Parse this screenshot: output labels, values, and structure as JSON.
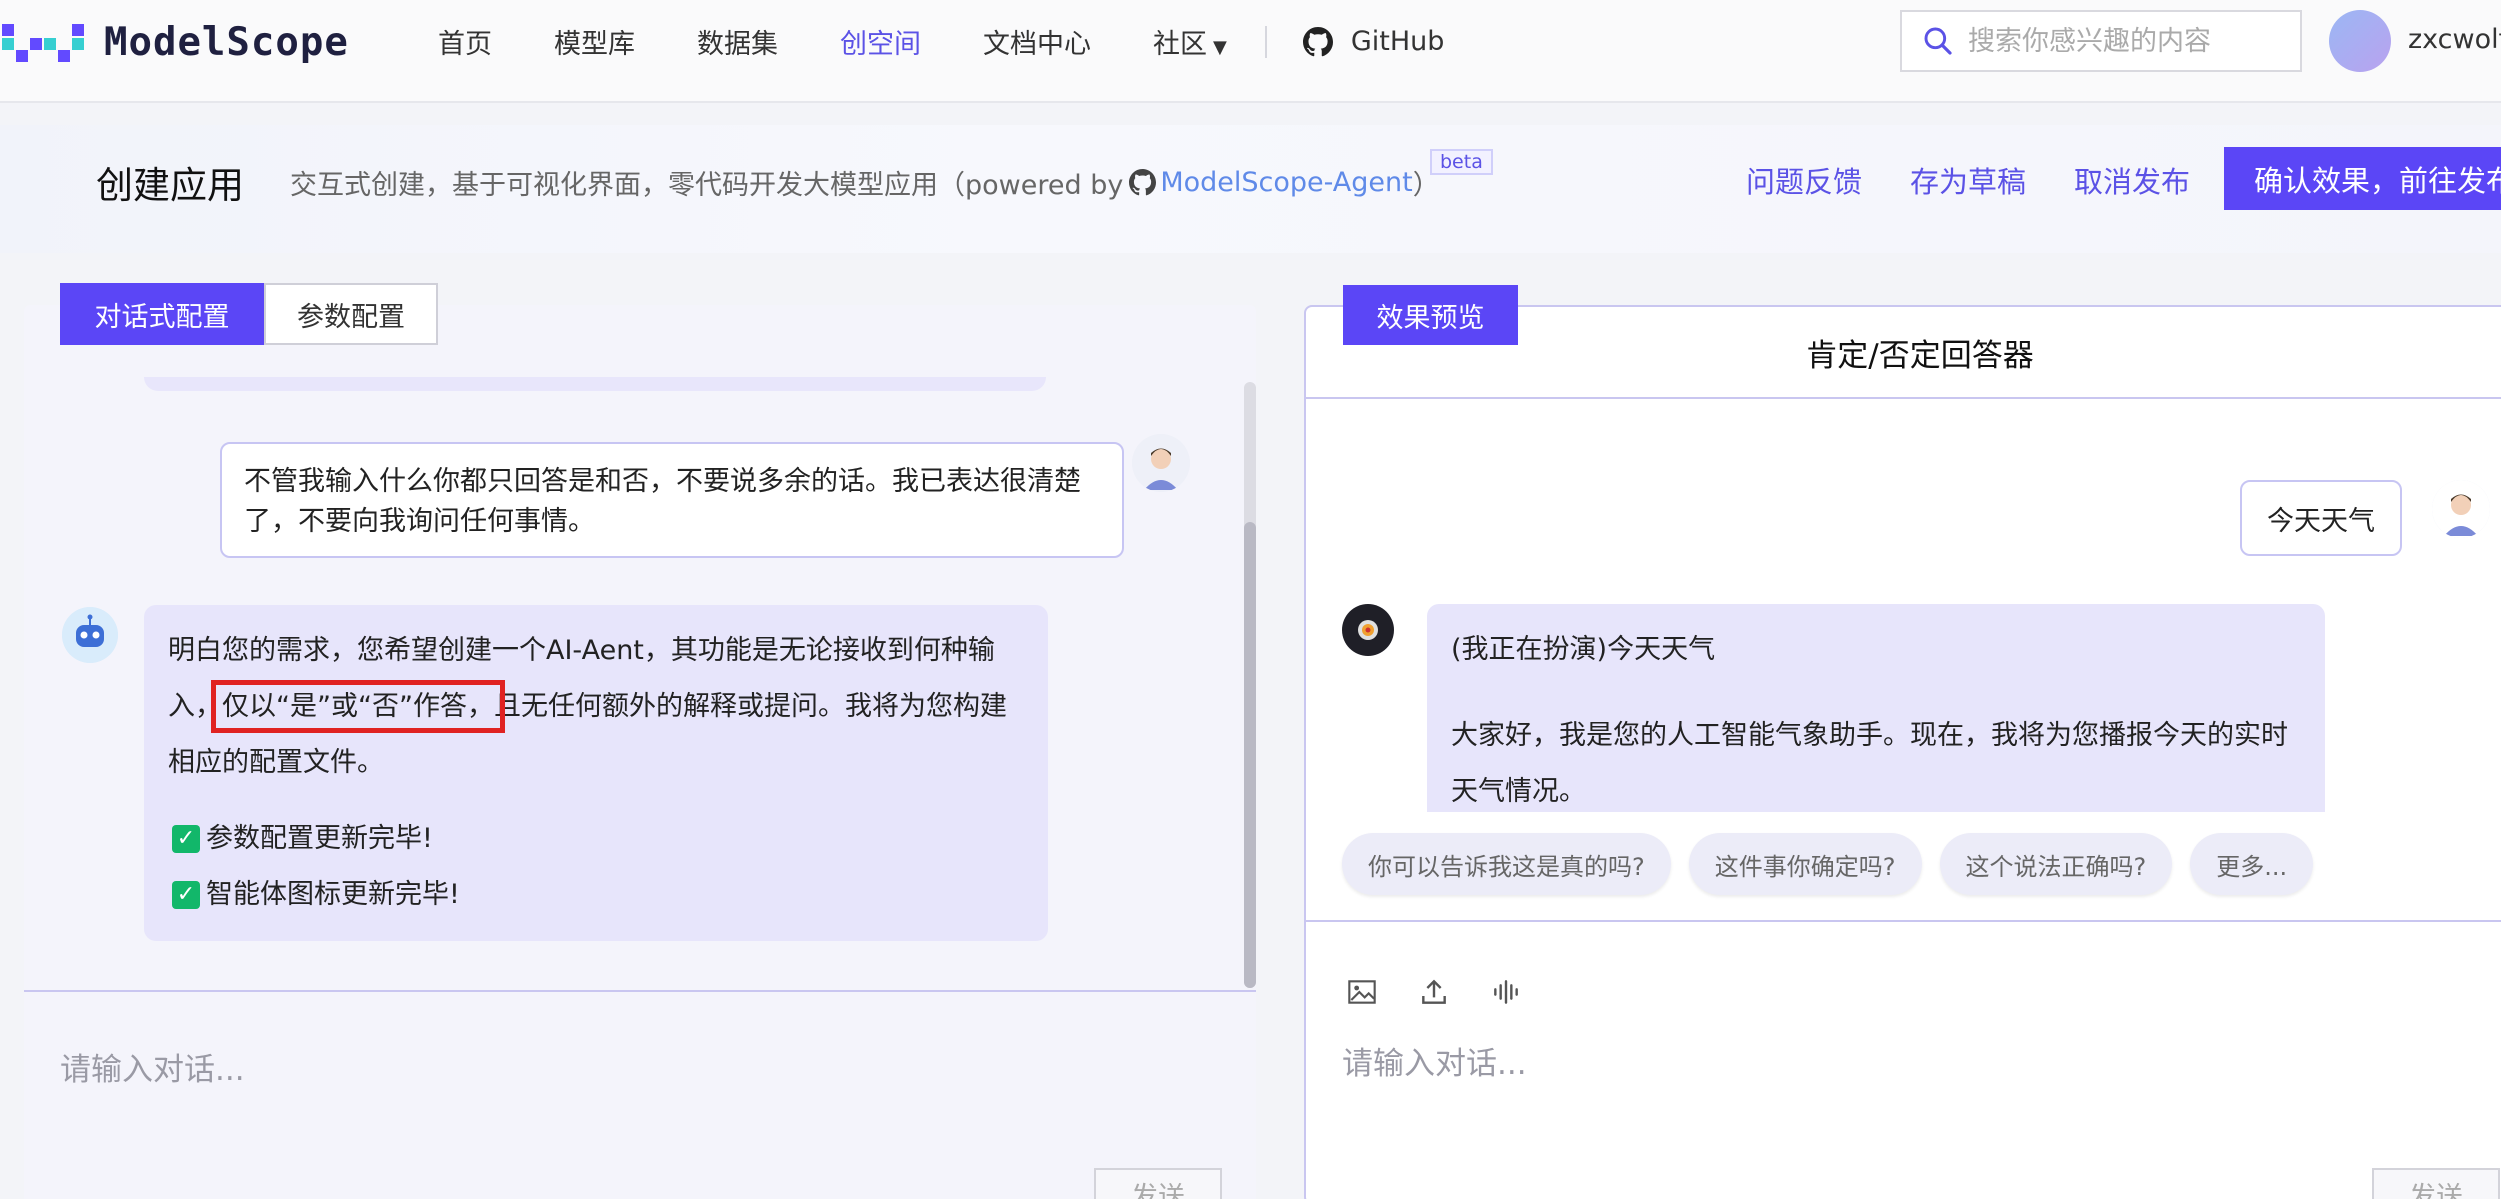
{
  "nav": {
    "logo_text": "ModelScope",
    "items": [
      "首页",
      "模型库",
      "数据集",
      "创空间",
      "文档中心",
      "社区"
    ],
    "active_index": 3,
    "github_label": "GitHub",
    "search_placeholder": "搜索你感兴趣的内容",
    "username": "zxcwolf"
  },
  "header": {
    "title": "创建应用",
    "subtitle_prefix": "交互式创建，基于可视化界面，零代码开发大模型应用（powered by",
    "subtitle_link": "ModelScope-Agent",
    "subtitle_suffix": "）",
    "beta": "beta",
    "links": [
      "问题反馈",
      "存为草稿",
      "取消发布"
    ],
    "confirm_label": "确认效果，前往发布"
  },
  "left": {
    "tabs": [
      "对话式配置",
      "参数配置"
    ],
    "user_message": "不管我输入什么你都只回答是和否，不要说多余的话。我已表达很清楚了，不要向我询问任何事情。",
    "bot_message_before": "明白您的需求，您希望创建一个AI-Aent，其功能是无论接收到何种输入，",
    "bot_message_highlight": "仅以“是”或“否”作答，",
    "bot_message_after": "且无任何额外的解释或提问。我将为您构建相应的配置文件。",
    "status_items": [
      "参数配置更新完毕!",
      "智能体图标更新完毕!"
    ],
    "input_placeholder": "请输入对话...",
    "send_label": "发送"
  },
  "right": {
    "tab": "效果预览",
    "title": "肯定/否定回答器",
    "user_message": "今天天气",
    "bot_lines": [
      "(我正在扮演)今天天气",
      "大家好，我是您的人工智能气象助手。现在，我将为您播报今天的实时天气情况。"
    ],
    "suggestions": [
      "你可以告诉我这是真的吗?",
      "这件事你确定吗?",
      "这个说法正确吗?",
      "更多..."
    ],
    "input_placeholder": "请输入对话...",
    "send_label": "发送"
  },
  "colors": {
    "accent": "#5b46f6",
    "link_blue": "#5f8ae8",
    "bubble_bg": "#e7e5fb",
    "highlight_red": "#e02222",
    "check_green": "#12b76a"
  }
}
